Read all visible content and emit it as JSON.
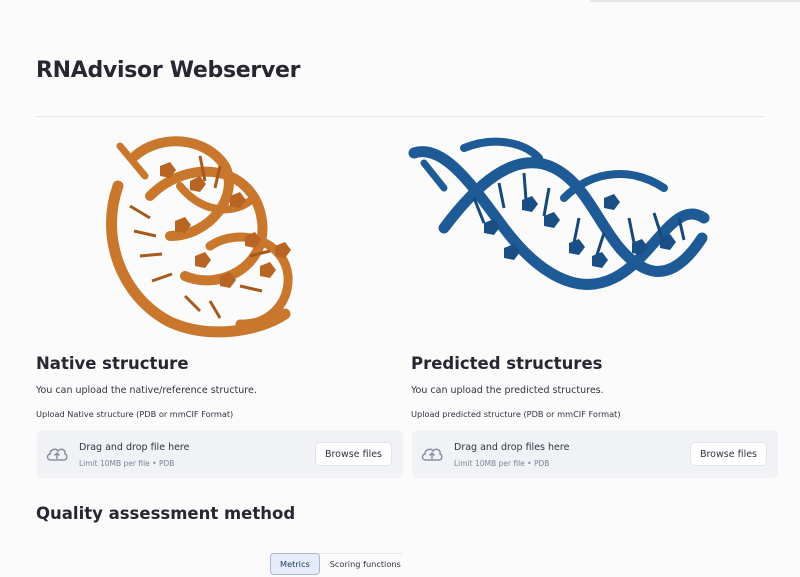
{
  "app": {
    "title": "RNAdvisor Webserver"
  },
  "native": {
    "heading": "Native structure",
    "description": "You can upload the native/reference structure.",
    "upload_label": "Upload Native structure (PDB or mmCIF Format)",
    "drop_text": "Drag and drop file here",
    "limit_text": "Limit 10MB per file • PDB",
    "browse_label": "Browse files",
    "image_color": "#c9772c"
  },
  "predicted": {
    "heading": "Predicted structures",
    "description": "You can upload the predicted structures.",
    "upload_label": "Upload predicted structure (PDB or mmCIF Format)",
    "drop_text": "Drag and drop files here",
    "limit_text": "Limit 10MB per file • PDB",
    "browse_label": "Browse files",
    "image_color": "#1e5a96"
  },
  "quality": {
    "heading": "Quality assessment method",
    "tabs": [
      {
        "label": "Metrics",
        "active": true
      },
      {
        "label": "Scoring functions",
        "active": false
      }
    ]
  },
  "icons": {
    "upload": "cloud-upload-icon"
  }
}
